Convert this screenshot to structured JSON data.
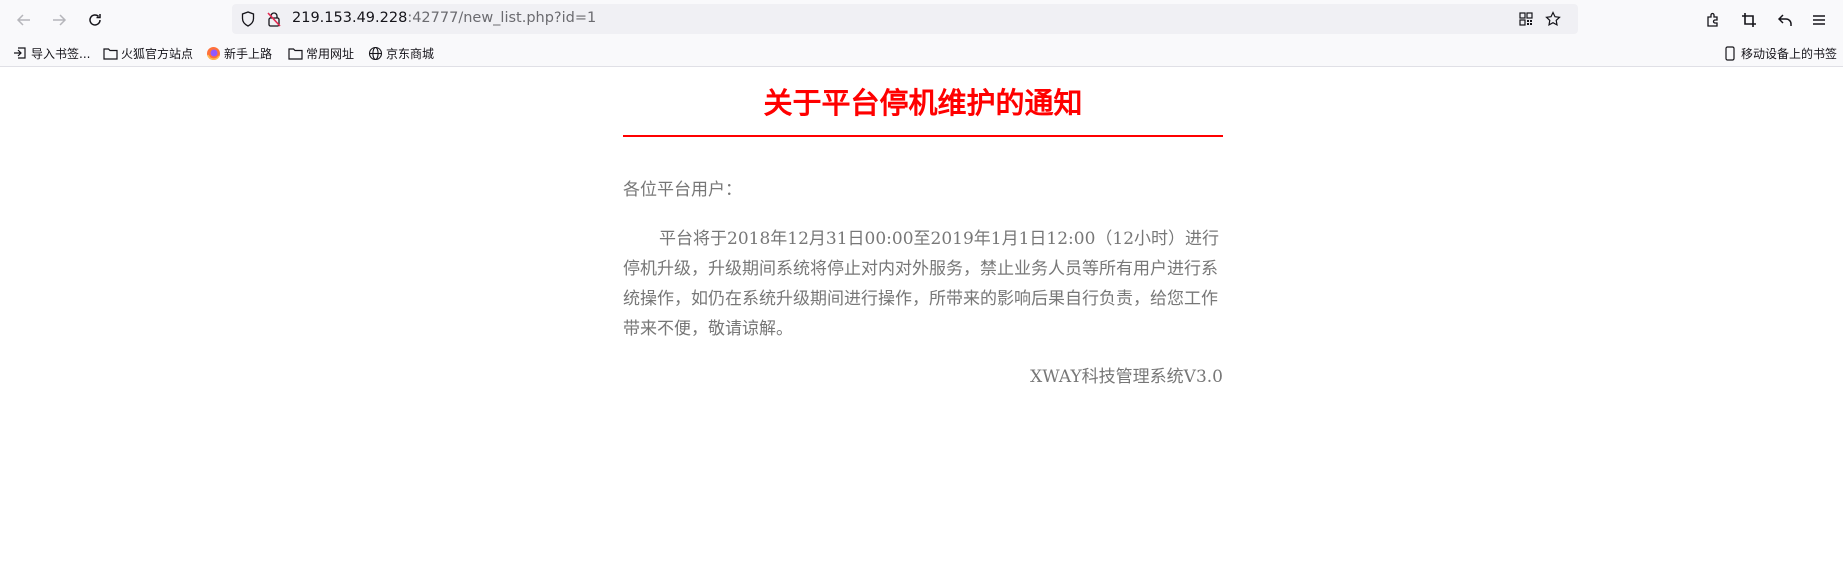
{
  "browser": {
    "url_host": "219.153.49.228",
    "url_rest": ":42777/new_list.php?id=1",
    "nav": {
      "back_icon": "arrow-left-icon",
      "forward_icon": "arrow-right-icon",
      "reload_icon": "reload-icon"
    },
    "right_icons": [
      "extensions-icon",
      "screenshot-icon",
      "undo-icon",
      "menu-icon"
    ]
  },
  "bookmarks": {
    "items": [
      {
        "label": "导入书签...",
        "icon": "import-icon"
      },
      {
        "label": "火狐官方站点",
        "icon": "folder-icon"
      },
      {
        "label": "新手上路",
        "icon": "firefox-icon"
      },
      {
        "label": "常用网址",
        "icon": "folder-icon"
      },
      {
        "label": "京东商城",
        "icon": "globe-icon"
      }
    ],
    "mobile_label": "移动设备上的书签"
  },
  "notice": {
    "title": "关于平台停机维护的通知",
    "greeting": "各位平台用户：",
    "body": "平台将于2018年12月31日00:00至2019年1月1日12:00（12小时）进行停机升级，升级期间系统将停止对内对外服务，禁止业务人员等所有用户进行系统操作，如仍在系统升级期间进行操作，所带来的影响后果自行负责，给您工作带来不便，敬请谅解。",
    "signature": "XWAY科技管理系统V3.0"
  },
  "colors": {
    "title_red": "#ff0000",
    "text_gray": "#777777"
  }
}
